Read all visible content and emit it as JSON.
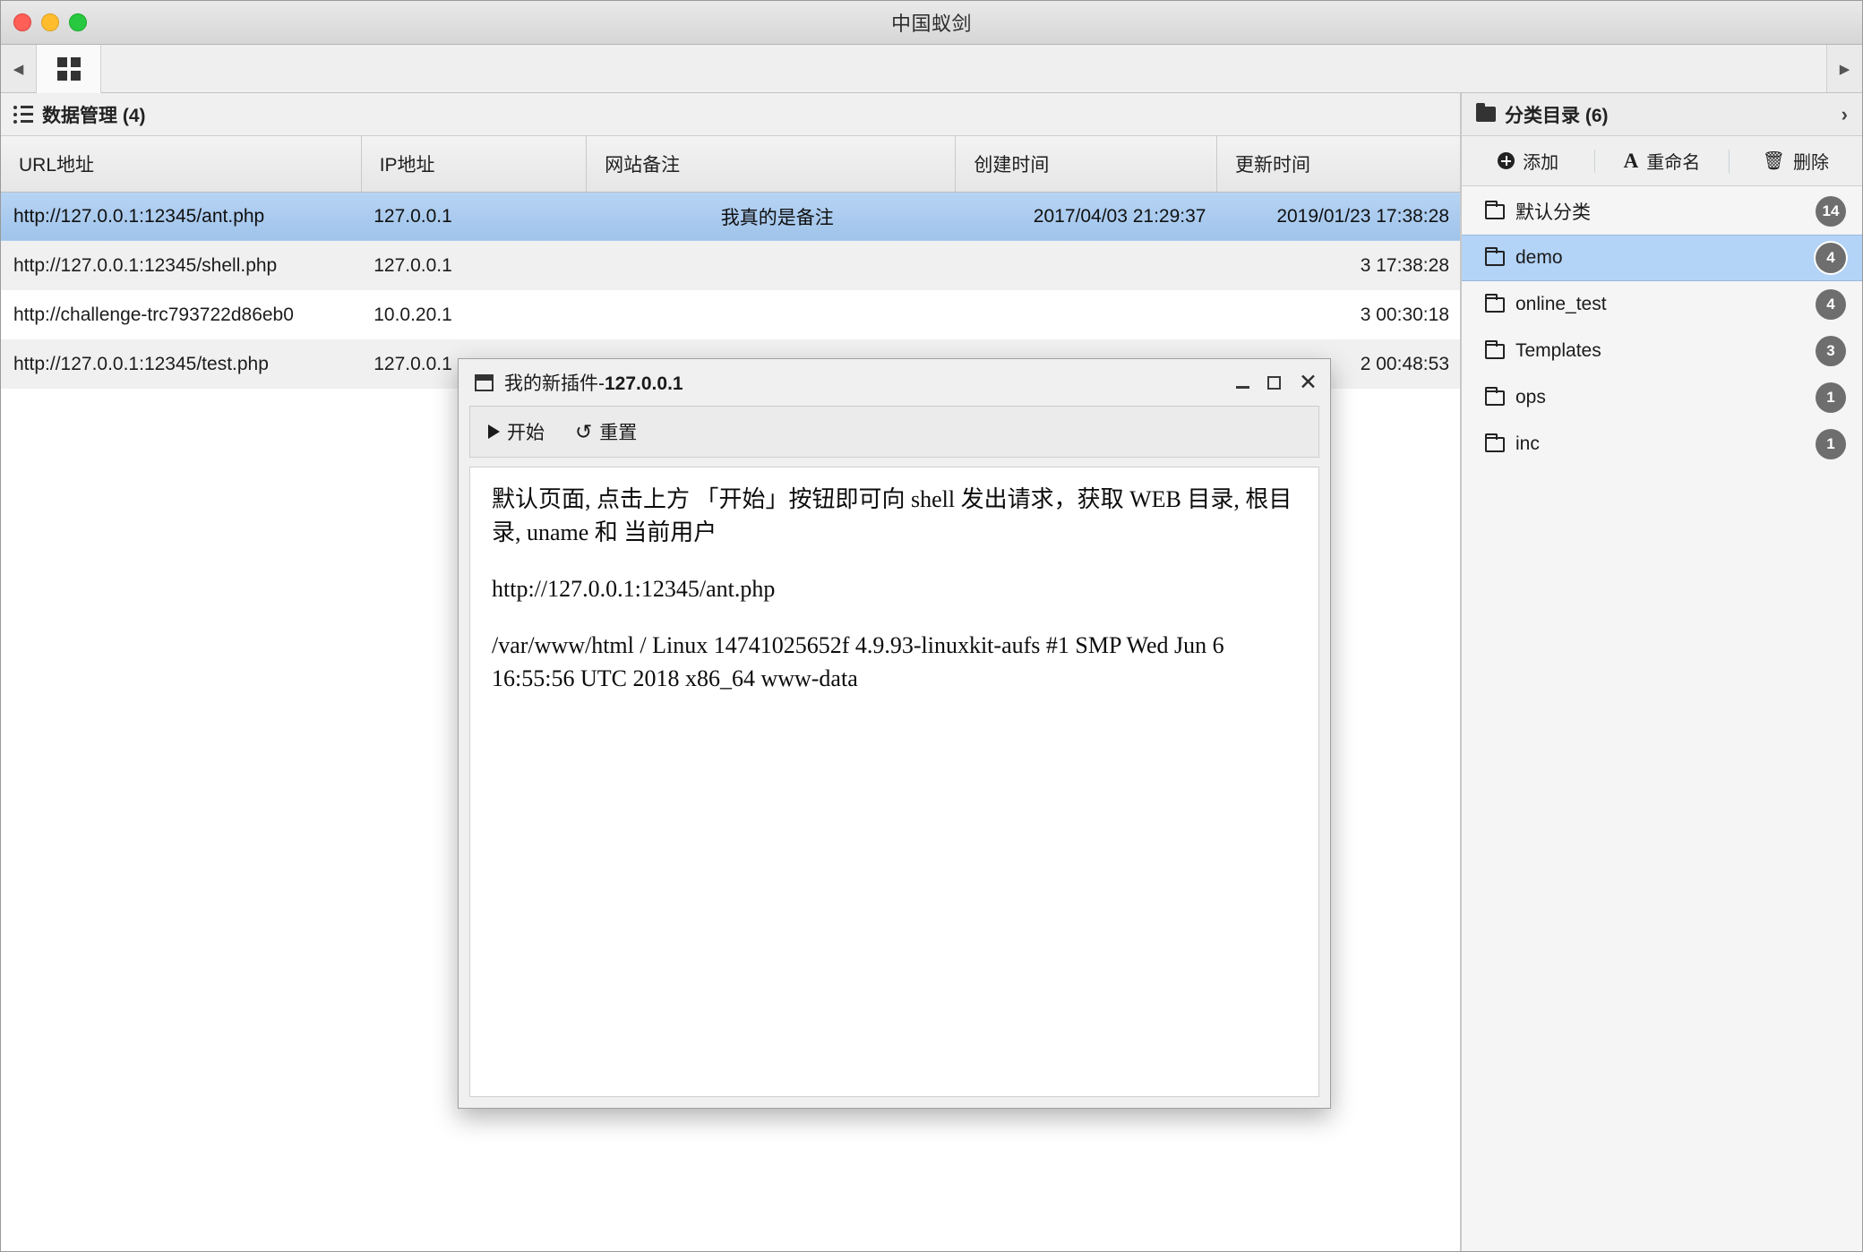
{
  "window": {
    "title": "中国蚁剑",
    "traffic_lights": [
      "close",
      "minimize",
      "maximize"
    ]
  },
  "tabstrip": {
    "scroll_left": "◀",
    "scroll_right": "▶",
    "active_tab_icon": "grid-icon"
  },
  "main": {
    "header": {
      "icon": "list-icon",
      "title": "数据管理 (4)"
    },
    "table": {
      "columns": [
        "URL地址",
        "IP地址",
        "网站备注",
        "创建时间",
        "更新时间"
      ],
      "rows": [
        {
          "url": "http://127.0.0.1:12345/ant.php",
          "ip": "127.0.0.1",
          "note": "我真的是备注",
          "created": "2017/04/03 21:29:37",
          "updated": "2019/01/23 17:38:28",
          "selected": true
        },
        {
          "url": "http://127.0.0.1:12345/shell.php",
          "ip": "127.0.0.1",
          "note": "",
          "created": "",
          "updated": "3 17:38:28",
          "selected": false
        },
        {
          "url": "http://challenge-trc793722d86eb0",
          "ip": "10.0.20.1",
          "note": "",
          "created": "",
          "updated": "3 00:30:18",
          "selected": false
        },
        {
          "url": "http://127.0.0.1:12345/test.php",
          "ip": "127.0.0.1",
          "note": "",
          "created": "",
          "updated": "2 00:48:53",
          "selected": false
        }
      ]
    }
  },
  "sidebar": {
    "header": {
      "icon": "folder-icon",
      "title": "分类目录 (6)",
      "expand_icon": "chevron-right-icon"
    },
    "toolbar": [
      {
        "label": "添加",
        "icon": "plus-circle-icon"
      },
      {
        "label": "重命名",
        "icon": "letter-a-icon"
      },
      {
        "label": "删除",
        "icon": "trash-icon"
      }
    ],
    "categories": [
      {
        "label": "默认分类",
        "count": "14",
        "selected": false
      },
      {
        "label": "demo",
        "count": "4",
        "selected": true
      },
      {
        "label": "online_test",
        "count": "4",
        "selected": false
      },
      {
        "label": "Templates",
        "count": "3",
        "selected": false
      },
      {
        "label": "ops",
        "count": "1",
        "selected": false
      },
      {
        "label": "inc",
        "count": "1",
        "selected": false
      }
    ]
  },
  "dialog": {
    "title_prefix": "我的新插件-",
    "title_host": "127.0.0.1",
    "controls": {
      "minimize": "_",
      "maximize": "□",
      "close": "✕"
    },
    "toolbar": [
      {
        "label": "开始",
        "icon": "play-icon"
      },
      {
        "label": "重置",
        "icon": "reset-icon"
      }
    ],
    "body": {
      "line1": "默认页面, 点击上方 「开始」按钮即可向 shell 发出请求，获取 WEB 目录, 根目录, uname 和 当前用户",
      "line2": "http://127.0.0.1:12345/ant.php",
      "line3": "/var/www/html / Linux 14741025652f 4.9.93-linuxkit-aufs #1 SMP Wed Jun 6 16:55:56 UTC 2018 x86_64 www-data"
    }
  },
  "colors": {
    "selection_blue": "#b3d3f7",
    "row_selected_top": "#b7d4f4",
    "badge_gray": "#6e6e6e",
    "titlebar": "#e0e0e0"
  }
}
